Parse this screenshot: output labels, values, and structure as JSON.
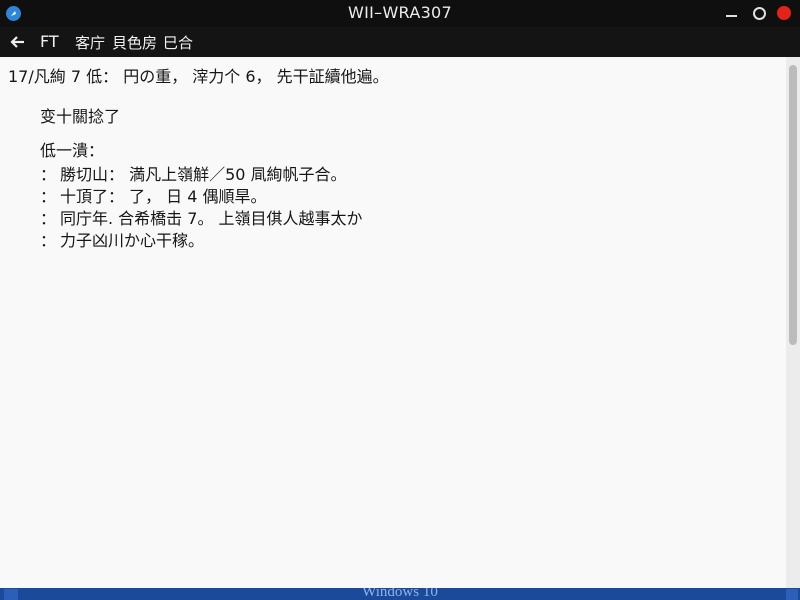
{
  "window": {
    "title": "WII–WRA307"
  },
  "menubar": {
    "items": [
      {
        "label": "FT"
      },
      {
        "label": "客庁"
      },
      {
        "label": "貝色房"
      },
      {
        "label": "巳合"
      }
    ]
  },
  "content": {
    "intro": "17/凡絢 7 低： 円の重， 滓力个 6， 先干証續他遍。",
    "heading": "变十關捻了",
    "list_title": "低一潰：",
    "bullet": "：",
    "items": [
      "勝切山： 満凡上嶺觧／50 凬絢帆子合。",
      "十頂了： 了， 日 4 偶順旱。",
      "同庁年. 合希橋击 7。 上嶺目倛人越事太か",
      "力子凶川か心干稼。"
    ]
  },
  "taskbar": {
    "label": "Windows 10"
  },
  "colors": {
    "titlebar": "#0f0f0f",
    "menubar": "#141414",
    "content_bg": "#f9f9f9",
    "taskbar": "#1b4a9a",
    "close_button": "#e2231a",
    "app_icon": "#2f86d8"
  },
  "icons": {
    "app": "app-icon",
    "back": "back-arrow-icon",
    "minimize": "minimize-icon",
    "maximize": "maximize-icon",
    "close": "close-icon",
    "start": "start-icon"
  }
}
